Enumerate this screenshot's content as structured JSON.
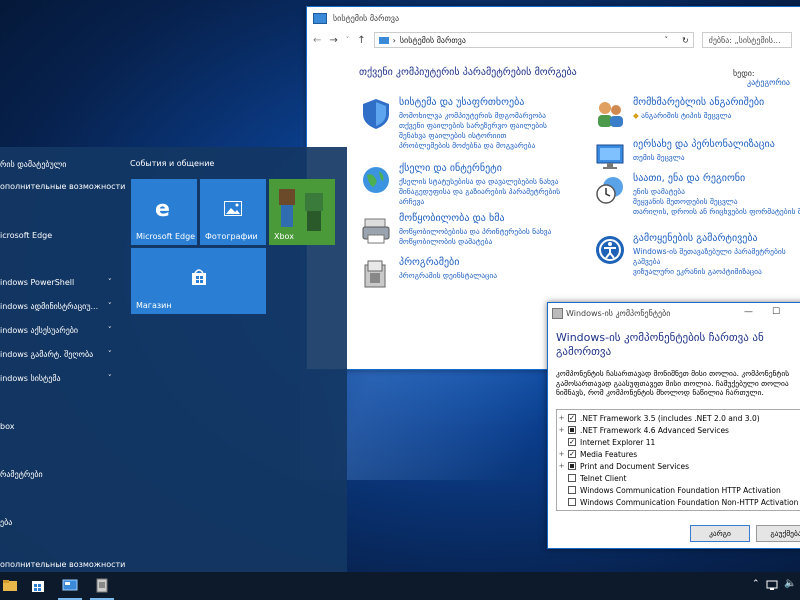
{
  "control_panel": {
    "title": "სისტემის მართვა",
    "address": "სისტემის მართვა",
    "search_placeholder": "ძებნა: „სისტემის...",
    "heading": "თქვენი კომპიუტერის პარამეტრების მორგება",
    "view_by_label": "ხედი:",
    "view_by_value": "კატეგორია",
    "categories": [
      {
        "title": "სისტემა და უსაფრთხოება",
        "links": [
          "მომოხილვა კომპიუტერის მდგომარეობა",
          "თქვენი ფაილების სარეზერვო ფაილების",
          "შენახვა ფაილების ისტორიით",
          "პრობლემების მოძებნა და მოგვარება"
        ]
      },
      {
        "title": "ქსელი და ინტერნეტი",
        "links": [
          "ქსელის სტატუსებისა და დავალებების ნახვა",
          "შინაგედუფისა და გაზიარების პარამეტრების",
          "არჩევა"
        ]
      },
      {
        "title": "მოწყობილობა და ხმა",
        "links": [
          "მოწყობილობებისა და პრინტერების ნახვა",
          "მოწყობილობის დამატება"
        ]
      },
      {
        "title": "პროგრამები",
        "links": [
          "პროგრამის დეინსტალაცია"
        ]
      },
      {
        "title": "მომხმარებლის ანგარიშები",
        "links": [
          "ანგარიშის ტიპის შეცვლა"
        ]
      },
      {
        "title": "იერსახე და პერსონალიზაცია",
        "links": [
          "თემის შეცვლა"
        ]
      },
      {
        "title": "საათი, ენა და რეგიონი",
        "links": [
          "ენის დამატება",
          "შეყვანის მეთოდების შეცვლა",
          "თარიღის, დროის ან რიცხვების ფორმატების შეცვლა"
        ]
      },
      {
        "title": "გამოყენების გამარტივება",
        "links": [
          "Windows-ის შეთავაზებული პარამეტრების",
          "გაშვება",
          "ვიზუალური ეკრანის გაოპტიმიზაცია"
        ]
      }
    ]
  },
  "start_menu": {
    "items": [
      {
        "label": "რის დამატებული"
      },
      {
        "label": "ополнительные возможности"
      },
      {
        "label": "icrosoft Edge"
      },
      {
        "label": "indows PowerShell"
      },
      {
        "label": "indows ადმინისტრაციუ..."
      },
      {
        "label": "indows აქსესუარები"
      },
      {
        "label": "indows გამარტ. შეღობა"
      },
      {
        "label": "indows სისტემა"
      },
      {
        "label": "box"
      },
      {
        "label": "რამეტრები"
      },
      {
        "label": "ება"
      },
      {
        "label": "ополнительные возможности"
      }
    ],
    "group_title": "События и общение",
    "tiles": [
      {
        "label": "Microsoft Edge"
      },
      {
        "label": "Фотографии"
      },
      {
        "label": "Xbox"
      },
      {
        "label": "Магазин"
      }
    ]
  },
  "features_dialog": {
    "title": "Windows-ის კომპონენტები",
    "heading": "Windows-ის კომპონენტების ჩართვა ან გამორთვა",
    "description": "კომპონენტის ჩასართავად მონიშნეთ მისი თოლია. კომპონენტის გამოსართავად გაასუფთავეთ მისი თოლია. ჩამუქებული თოლია ნიშნავს, რომ კომპონენტის მხოლოდ ნაწილია ჩართული.",
    "features": [
      {
        "label": ".NET Framework 3.5 (includes .NET 2.0 and 3.0)",
        "expander": "+",
        "state": "checked"
      },
      {
        "label": ".NET Framework 4.6 Advanced Services",
        "expander": "+",
        "state": "partial"
      },
      {
        "label": "Internet Explorer 11",
        "expander": "",
        "state": "checked"
      },
      {
        "label": "Media Features",
        "expander": "+",
        "state": "checked"
      },
      {
        "label": "Print and Document Services",
        "expander": "+",
        "state": "partial"
      },
      {
        "label": "Telnet Client",
        "expander": "",
        "state": "unchecked"
      },
      {
        "label": "Windows Communication Foundation HTTP Activation",
        "expander": "",
        "state": "unchecked"
      },
      {
        "label": "Windows Communication Foundation Non-HTTP Activation",
        "expander": "",
        "state": "unchecked"
      }
    ],
    "ok_label": "კარგი",
    "cancel_label": "გაუქმება"
  },
  "colors": {
    "accent": "#1e5fbf",
    "tile": "#2a7fd4",
    "start_bg": "#143764"
  }
}
